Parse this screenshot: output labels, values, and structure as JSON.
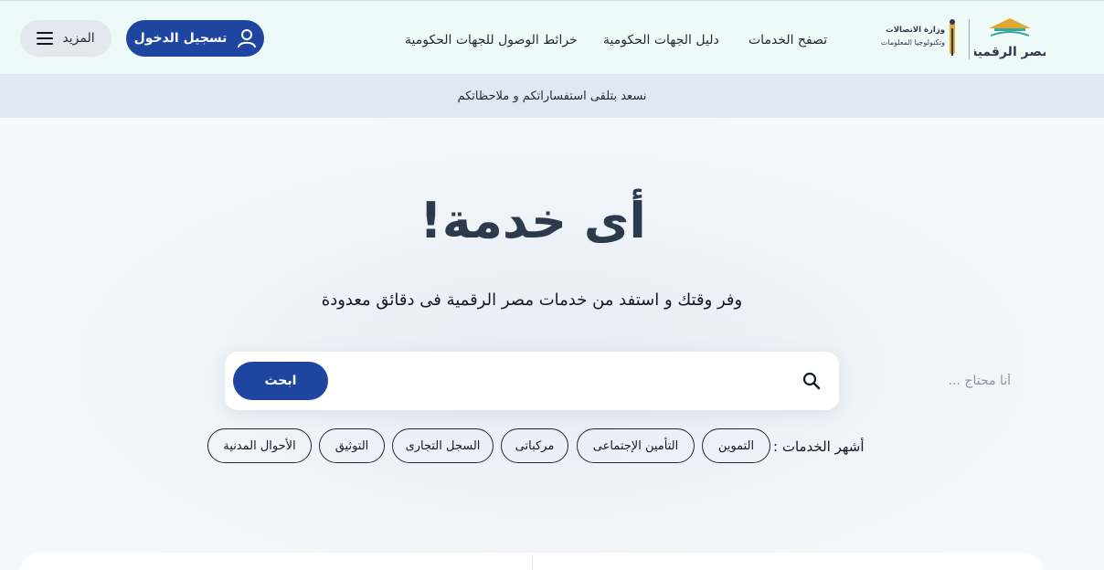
{
  "header": {
    "more_label": "المزيد",
    "login_label": "تسجيل الدخول",
    "nav": [
      {
        "label": "خرائط الوصول للجهات الحكومية"
      },
      {
        "label": "دليل الجهات الحكومية"
      },
      {
        "label": "تصفح الخدمات"
      }
    ],
    "ministry_logo_text": "وزارة الاتصالات وتكنولوجيا المعلومات",
    "brand_logo_text": "مصر الرقمية"
  },
  "banner": {
    "text": "نسعد بتلقى استفساراتكم و ملاحظاتكم"
  },
  "hero": {
    "title": "أى خدمة!",
    "subtitle": "وفر وقتك و استفد من خدمات مصر الرقمية فى دقائق معدودة"
  },
  "search": {
    "placeholder": "أنا محتاج ...",
    "value": "",
    "button_label": "ابحث"
  },
  "popular": {
    "label": "أشهر الخدمات :",
    "chips": [
      {
        "label": "التموين"
      },
      {
        "label": "التأمين الإجتماعى"
      },
      {
        "label": "مركباتى"
      },
      {
        "label": "السجل التجارى"
      },
      {
        "label": "التوثيق"
      },
      {
        "label": "الأحوال المدنية"
      }
    ]
  },
  "colors": {
    "primary": "#1e46a0",
    "topbar_bg": "#eefaf7",
    "banner_bg": "#dfe8f4",
    "title_color": "#2d3a4b"
  }
}
